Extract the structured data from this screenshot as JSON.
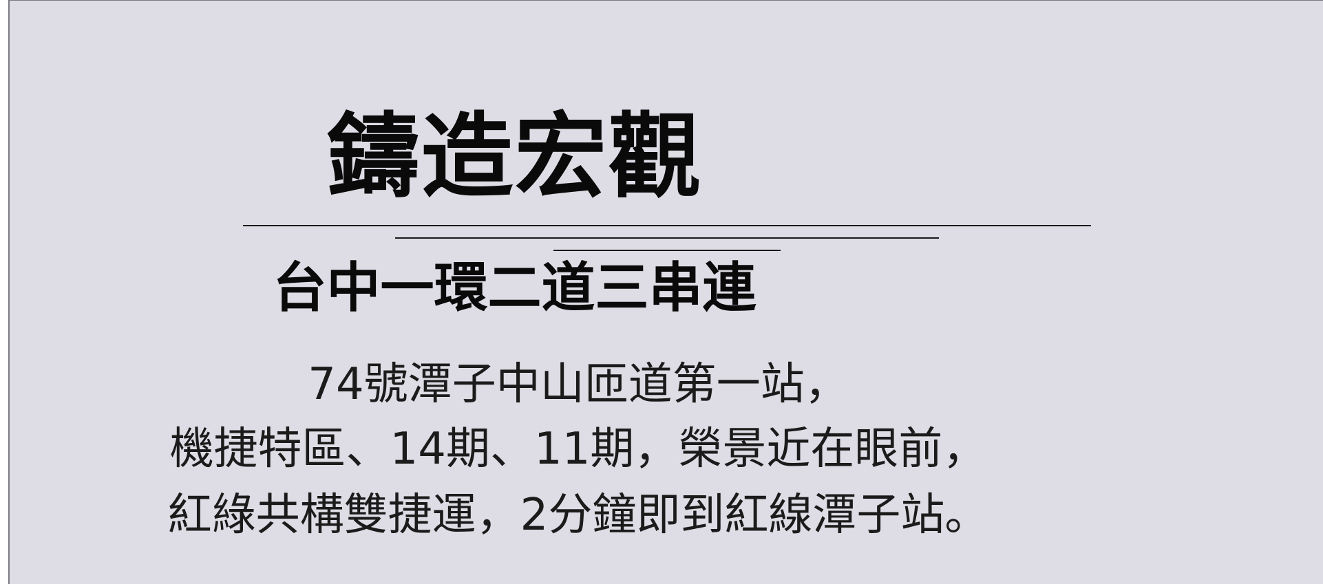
{
  "headline": {
    "title": "鑄造宏觀",
    "subtitle": "台中一環二道三串連"
  },
  "body": {
    "lines": [
      "74號潭子中山匝道第一站，",
      "機捷特區、14期、11期，榮景近在眼前，",
      "紅綠共構雙捷運，2分鐘即到紅線潭子站。"
    ]
  },
  "colors": {
    "background": "#DEDDE5",
    "text": "#0A0A0A",
    "rules": "#1A1A1A"
  }
}
